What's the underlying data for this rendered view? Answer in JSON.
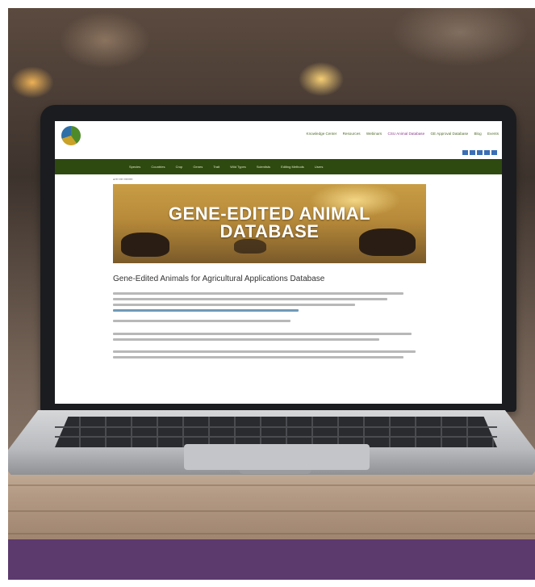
{
  "website": {
    "top_nav": [
      "Knowledge Center",
      "Resources",
      "Webinars",
      "CSU Animal Database",
      "GE Approval Database",
      "Blog",
      "Events"
    ],
    "green_nav": [
      "Species",
      "Countries",
      "Crop",
      "Genes",
      "Trait",
      "Wild Types",
      "Scientists",
      "Editing Methods",
      "Users"
    ],
    "hero_title_line1": "GENE-EDITED ANIMAL",
    "hero_title_line2": "DATABASE",
    "page_heading": "Gene-Edited Animals for Agricultural Applications Database"
  },
  "colors": {
    "site_green_bar": "#2f4a10",
    "bottom_band": "#5c3a6e"
  }
}
